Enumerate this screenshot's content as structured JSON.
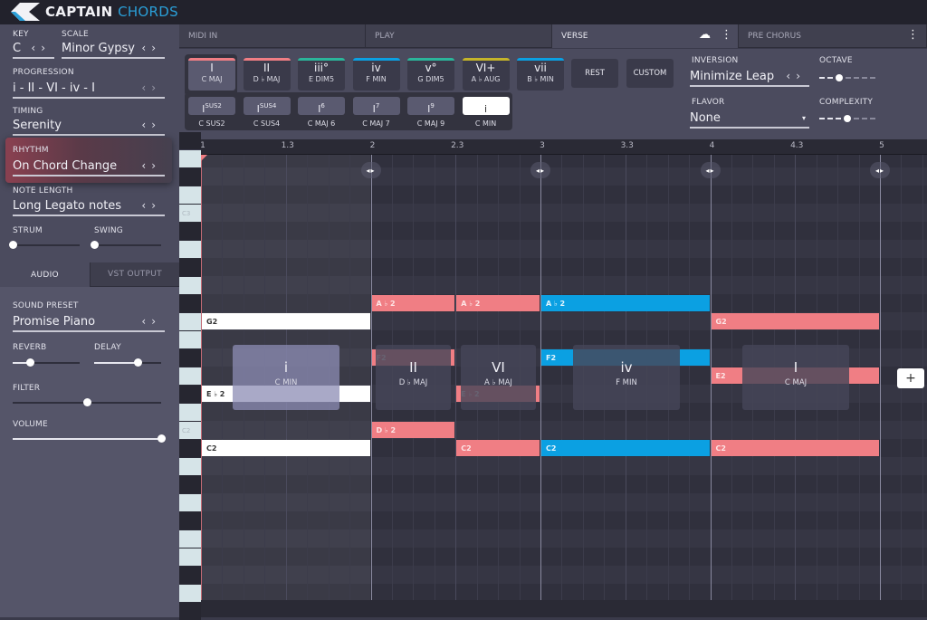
{
  "app": {
    "title_part1": "CAPTAIN",
    "title_part2": "CHORDS",
    "brand_blue": "#2a9fd8"
  },
  "sidebar": {
    "key": {
      "label": "KEY",
      "value": "C"
    },
    "scale": {
      "label": "SCALE",
      "value": "Minor Gypsy"
    },
    "progression": {
      "label": "PROGRESSION",
      "value": "i - II - VI - iv - I"
    },
    "timing": {
      "label": "TIMING",
      "value": "Serenity"
    },
    "rhythm": {
      "label": "RHYTHM",
      "value": "On Chord Change"
    },
    "note_length": {
      "label": "NOTE LENGTH",
      "value": "Long Legato notes"
    },
    "strum": {
      "label": "STRUM",
      "value": 0
    },
    "swing": {
      "label": "SWING",
      "value": 0
    },
    "tabs": [
      {
        "label": "AUDIO",
        "active": true
      },
      {
        "label": "VST  OUTPUT",
        "active": false
      }
    ],
    "sound_preset": {
      "label": "SOUND PRESET",
      "value": "Promise Piano"
    },
    "reverb": {
      "label": "REVERB",
      "value": 0.25
    },
    "delay": {
      "label": "DELAY",
      "value": 0.65
    },
    "filter": {
      "label": "FILTER",
      "value": 0.5
    },
    "volume": {
      "label": "VOLUME",
      "value": 1.0
    },
    "arrow_left": "‹",
    "arrow_right": "›"
  },
  "sections": [
    {
      "label": "MIDI IN",
      "active": false
    },
    {
      "label": "PLAY",
      "active": false
    },
    {
      "label": "VERSE",
      "active": true
    },
    {
      "label": "PRE CHORUS",
      "active": false
    }
  ],
  "icons": {
    "cloud_download": "☁",
    "more_vert": "⋮"
  },
  "chord_buttons": [
    {
      "numeral": "I",
      "name": "C MAJ",
      "color": "#f07e84",
      "selected": true
    },
    {
      "numeral": "II",
      "name": "D ♭ MAJ",
      "color": "#f07e84",
      "selected": false
    },
    {
      "numeral": "iii°",
      "name": "E DIM5",
      "color": "#2bb59a",
      "selected": false
    },
    {
      "numeral": "iv",
      "name": "F MIN",
      "color": "#0ba0e2",
      "selected": false
    },
    {
      "numeral": "v°",
      "name": "G DIM5",
      "color": "#2bb59a",
      "selected": false
    },
    {
      "numeral": "VI+",
      "name": "A ♭ AUG",
      "color": "#c4b42a",
      "selected": false
    },
    {
      "numeral": "vii",
      "name": "B ♭ MIN",
      "color": "#0ba0e2",
      "selected": false
    }
  ],
  "rest_label": "REST",
  "custom_label": "CUSTOM",
  "variations": [
    {
      "base": "I",
      "sup": "SUS2",
      "name": "C SUS2",
      "selected": false
    },
    {
      "base": "I",
      "sup": "SUS4",
      "name": "C SUS4",
      "selected": false
    },
    {
      "base": "I",
      "sup": "6",
      "name": "C MAJ 6",
      "selected": false
    },
    {
      "base": "I",
      "sup": "7",
      "name": "C MAJ 7",
      "selected": false
    },
    {
      "base": "I",
      "sup": "9",
      "name": "C MAJ 9",
      "selected": false
    },
    {
      "base": "i",
      "sup": "",
      "name": "C MIN",
      "selected": true
    }
  ],
  "inversion": {
    "label": "INVERSION",
    "value": "Minimize Leap"
  },
  "flavor": {
    "label": "FLAVOR",
    "value": "None",
    "caret": "▾"
  },
  "octave": {
    "label": "OCTAVE",
    "steps": 7,
    "value_index": 2
  },
  "complexity": {
    "label": "COMPLEXITY",
    "steps": 7,
    "value_index": 3
  },
  "ruler": [
    "1",
    "1.3",
    "2",
    "2.3",
    "3",
    "3.3",
    "4",
    "4.3",
    "5"
  ],
  "piano_labels": {
    "c3": "C3",
    "c2": "C2"
  },
  "marker_glyph": "◂▸",
  "add_label": "+",
  "chords": [
    {
      "numeral": "i",
      "name": "C MIN"
    },
    {
      "numeral": "II",
      "name": "D ♭ MAJ"
    },
    {
      "numeral": "VI",
      "name": "A ♭ MAJ"
    },
    {
      "numeral": "iv",
      "name": "F MIN"
    },
    {
      "numeral": "I",
      "name": "C MAJ"
    }
  ],
  "notes": [
    {
      "label": "G2",
      "row": 9,
      "start": 0,
      "end": 1,
      "color": "white"
    },
    {
      "label": "E ♭ 2",
      "row": 13,
      "start": 0,
      "end": 1,
      "color": "white"
    },
    {
      "label": "C2",
      "row": 16,
      "start": 0,
      "end": 1,
      "color": "white"
    },
    {
      "label": "A ♭ 2",
      "row": 8,
      "start": 1,
      "end": 1.5,
      "color": "red"
    },
    {
      "label": "F2",
      "row": 11,
      "start": 1,
      "end": 1.5,
      "color": "red"
    },
    {
      "label": "D ♭ 2",
      "row": 15,
      "start": 1,
      "end": 1.5,
      "color": "red"
    },
    {
      "label": "A ♭ 2",
      "row": 8,
      "start": 1.5,
      "end": 2,
      "color": "red"
    },
    {
      "label": "E ♭ 2",
      "row": 13,
      "start": 1.5,
      "end": 2,
      "color": "red"
    },
    {
      "label": "C2",
      "row": 16,
      "start": 1.5,
      "end": 2,
      "color": "red"
    },
    {
      "label": "A ♭ 2",
      "row": 8,
      "start": 2,
      "end": 3,
      "color": "blue"
    },
    {
      "label": "F2",
      "row": 11,
      "start": 2,
      "end": 3,
      "color": "blue"
    },
    {
      "label": "C2",
      "row": 16,
      "start": 2,
      "end": 3,
      "color": "blue"
    },
    {
      "label": "G2",
      "row": 9,
      "start": 3,
      "end": 4,
      "color": "red"
    },
    {
      "label": "E2",
      "row": 12,
      "start": 3,
      "end": 4,
      "color": "red"
    },
    {
      "label": "C2",
      "row": 16,
      "start": 3,
      "end": 4,
      "color": "red"
    }
  ]
}
